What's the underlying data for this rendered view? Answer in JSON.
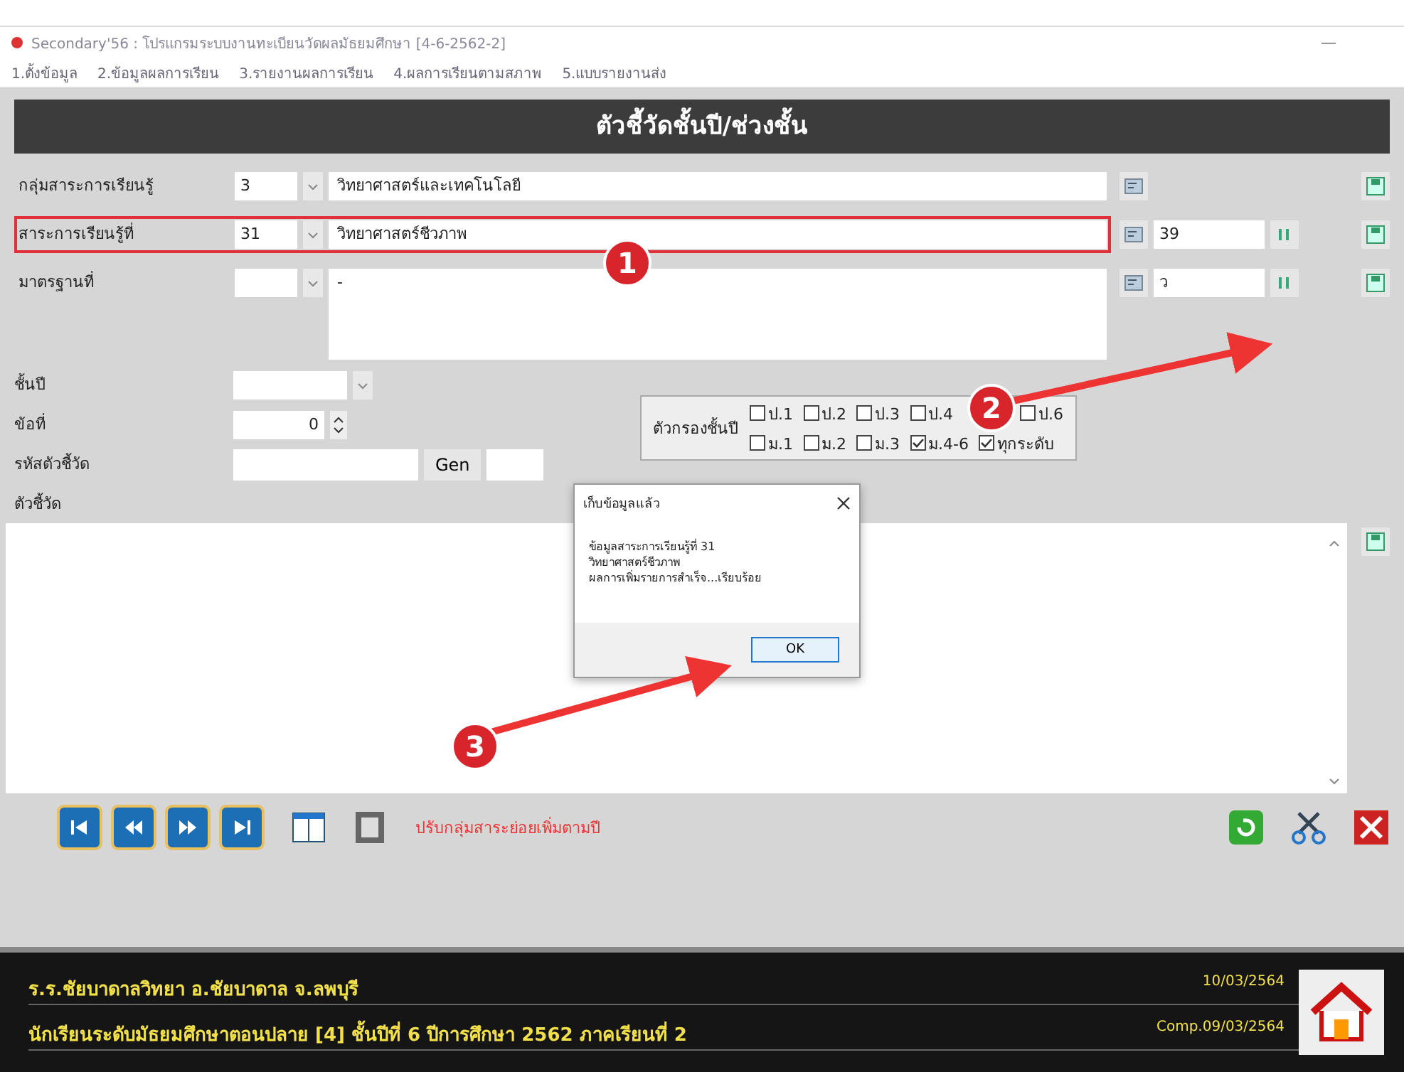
{
  "window": {
    "title": "Secondary'56 : โปรแกรมระบบงานทะเบียนวัดผลมัธยมศึกษา [4-6-2562-2]"
  },
  "menu": [
    "1.ตั้งข้อมูล",
    "2.ข้อมูลผลการเรียน",
    "3.รายงานผลการเรียน",
    "4.ผลการเรียนตามสภาพ",
    "5.แบบรายงานส่ง"
  ],
  "header": "ตัวชี้วัดชั้นปี/ช่วงชั้น",
  "fields": [
    {
      "kind": "single",
      "label": "กลุ่มสาระการเรียนรู้",
      "code": "3",
      "name": "วิทยาศาสตร์และเทคโนโลยี",
      "highlighted": false
    },
    {
      "kind": "numbered",
      "label": "สาระการเรียนรู้ที่",
      "code": "31",
      "name": "วิทยาศาสตร์ชีวภาพ",
      "number": "39",
      "highlighted": true
    },
    {
      "kind": "multiline",
      "label": "มาตรฐานที่",
      "name": "-",
      "number": "ว",
      "highlighted": false
    }
  ],
  "grade": {
    "label": "ชั้นปี"
  },
  "item_no": {
    "label": "ข้อที่",
    "value": "0"
  },
  "indicator_code": {
    "label": "รหัสตัวชี้วัด",
    "button": "Gen"
  },
  "indicator": {
    "label": "ตัวชี้วัด"
  },
  "filter": {
    "label": "ตัวกรองชั้นปี",
    "rows": [
      [
        {
          "label": "ป.1",
          "checked": false
        },
        {
          "label": "ป.2",
          "checked": false
        },
        {
          "label": "ป.3",
          "checked": false
        },
        {
          "label": "ป.4",
          "checked": false
        },
        {
          "label": "ป.6",
          "checked": false
        }
      ],
      [
        {
          "label": "ม.1",
          "checked": false
        },
        {
          "label": "ม.2",
          "checked": false
        },
        {
          "label": "ม.3",
          "checked": false
        },
        {
          "label": "ม.4-6",
          "checked": true
        },
        {
          "label": "ทุกระดับ",
          "checked": true
        }
      ]
    ]
  },
  "dialog": {
    "title": "เก็บข้อมูลแล้ว",
    "lines": [
      "ข้อมูลสาระการเรียนรู้ที่ 31",
      "วิทยาศาสตร์ชีวภาพ",
      "ผลการเพิ่มรายการสำเร็จ...เรียบร้อย"
    ],
    "button": "OK"
  },
  "toolbar": {
    "message": "ปรับกลุ่มสาระย่อยเพิ่มตามปี"
  },
  "footer": {
    "school": "ร.ร.ชัยบาดาลวิทยา  อ.ชัยบาดาล  จ.ลพบุรี",
    "date": "10/03/2564",
    "class_info": "นักเรียนระดับมัธยมศึกษาตอนปลาย [4]  ชั้นปีที่ 6  ปีการศึกษา 2562  ภาคเรียนที่ 2",
    "computed": "Comp.09/03/2564"
  },
  "annotations": [
    {
      "label": "1"
    },
    {
      "label": "2"
    },
    {
      "label": "3"
    }
  ]
}
